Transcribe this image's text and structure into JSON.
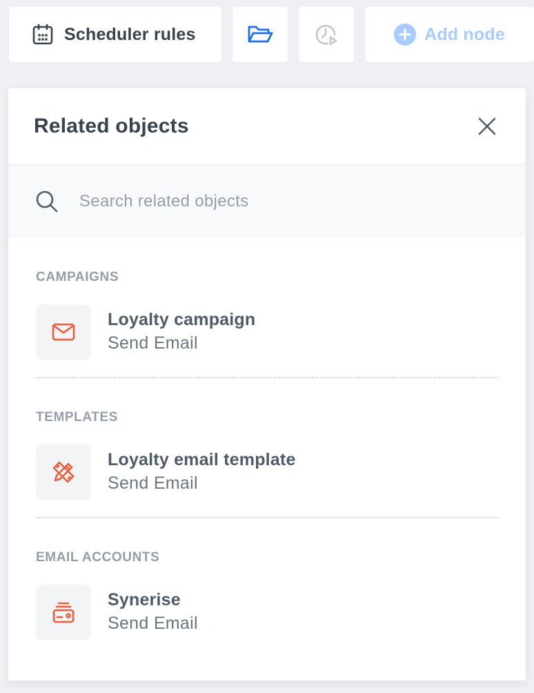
{
  "toolbar": {
    "scheduler_label": "Scheduler rules",
    "add_node_label": "Add node",
    "icons": [
      "calendar-icon",
      "folder-open-icon",
      "history-icon",
      "plus-circle-icon"
    ],
    "colors": {
      "folder_icon": "#1c6cf5",
      "add_node_disabled": "#a9cbfd"
    }
  },
  "panel": {
    "title": "Related objects",
    "search": {
      "placeholder": "Search related objects",
      "value": ""
    },
    "sections": [
      {
        "title": "CAMPAIGNS",
        "items": [
          {
            "icon": "mail-icon",
            "title": "Loyalty campaign",
            "subtitle": "Send Email"
          }
        ]
      },
      {
        "title": "TEMPLATES",
        "items": [
          {
            "icon": "pencil-ruler-icon",
            "title": "Loyalty email template",
            "subtitle": "Send Email"
          }
        ]
      },
      {
        "title": "EMAIL ACCOUNTS",
        "items": [
          {
            "icon": "wallet-icon",
            "title": "Synerise",
            "subtitle": "Send Email"
          }
        ]
      }
    ],
    "colors": {
      "item_icon": "#f05a36"
    }
  }
}
